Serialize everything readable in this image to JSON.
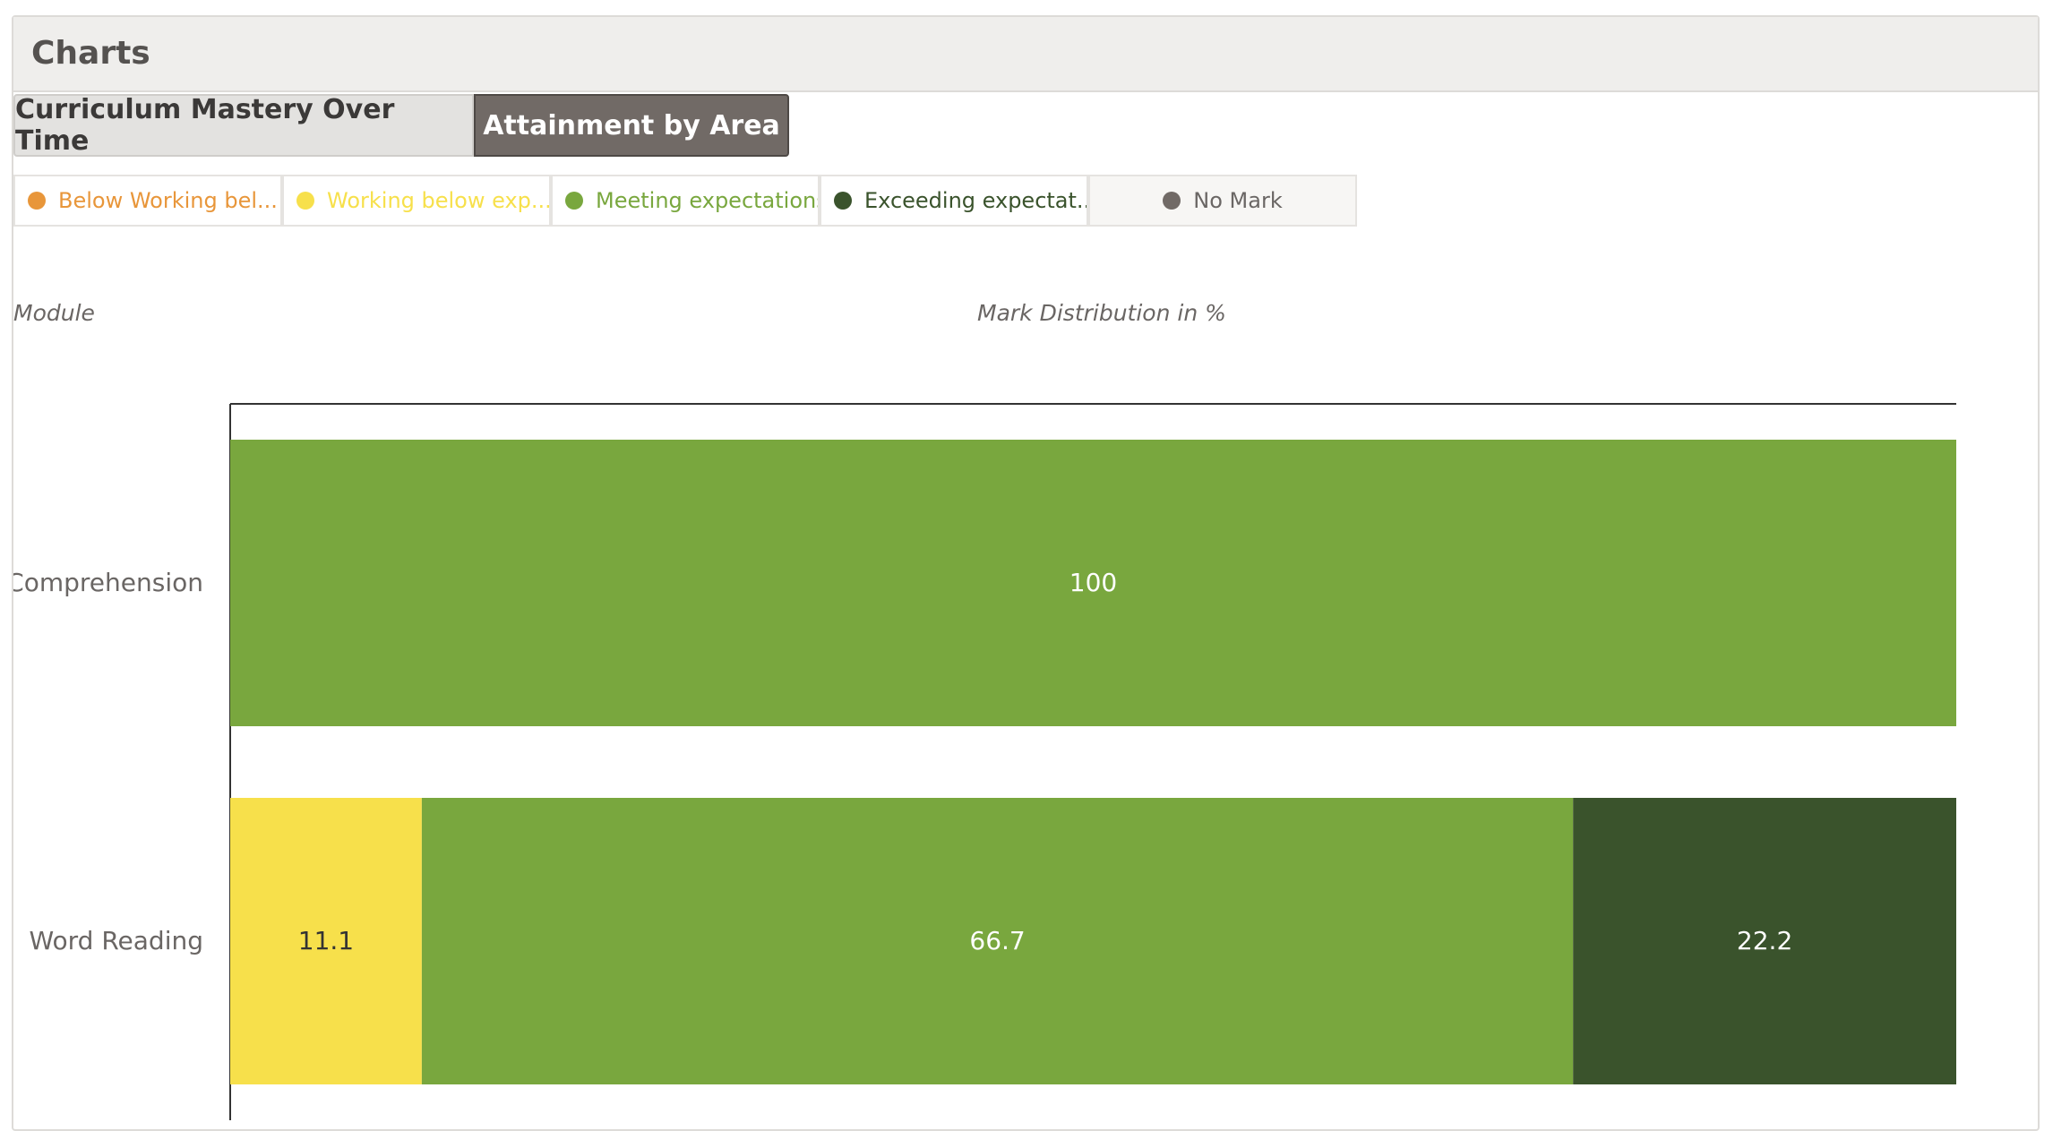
{
  "panel": {
    "title": "Charts"
  },
  "tabs": [
    {
      "label": "Curriculum Mastery Over Time",
      "active": false
    },
    {
      "label": "Attainment by Area",
      "active": true
    }
  ],
  "legend": [
    {
      "label": "Below Working bel...",
      "color": "#e8963a"
    },
    {
      "label": "Working below exp...",
      "color": "#f7e04b"
    },
    {
      "label": "Meeting expectations",
      "color": "#79a73e"
    },
    {
      "label": "Exceeding expectat...",
      "color": "#3a532c"
    },
    {
      "label": "No Mark",
      "color": "#716a66"
    }
  ],
  "axis_captions": {
    "y": "Module",
    "x": "Mark Distribution in %"
  },
  "chart_data": {
    "type": "bar",
    "orientation": "horizontal",
    "stacked": true,
    "categories": [
      "Comprehension",
      "Word Reading"
    ],
    "series": [
      {
        "name": "Below Working bel...",
        "values": [
          0,
          0
        ],
        "color": "#e8963a",
        "label_color": "#333333"
      },
      {
        "name": "Working below exp...",
        "values": [
          0,
          11.1
        ],
        "color": "#f7e04b",
        "label_color": "#333333"
      },
      {
        "name": "Meeting expectations",
        "values": [
          100,
          66.7
        ],
        "color": "#79a73e",
        "label_color": "#ffffff"
      },
      {
        "name": "Exceeding expectat...",
        "values": [
          0,
          22.2
        ],
        "color": "#3a532c",
        "label_color": "#ffffff"
      },
      {
        "name": "No Mark",
        "values": [
          0,
          0
        ],
        "color": "#716a66",
        "label_color": "#ffffff"
      }
    ],
    "xlim": [
      0,
      100
    ],
    "xlabel": "Mark Distribution in %",
    "ylabel": "Module",
    "grid": false,
    "legend_position": "top-left"
  }
}
